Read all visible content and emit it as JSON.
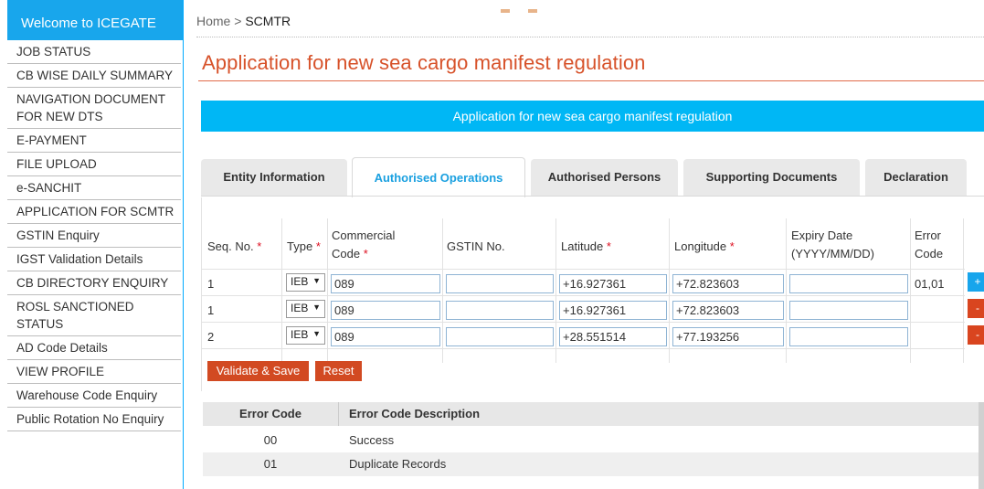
{
  "sidebar": {
    "welcome": "Welcome to ICEGATE",
    "items": [
      {
        "label": "JOB STATUS"
      },
      {
        "label": "CB WISE DAILY SUMMARY"
      },
      {
        "label": "NAVIGATION DOCUMENT FOR NEW DTS"
      },
      {
        "label": "E-PAYMENT"
      },
      {
        "label": "FILE UPLOAD"
      },
      {
        "label": "e-SANCHIT"
      },
      {
        "label": "APPLICATION FOR SCMTR"
      },
      {
        "label": "GSTIN Enquiry"
      },
      {
        "label": "IGST Validation Details"
      },
      {
        "label": "CB DIRECTORY ENQUIRY"
      },
      {
        "label": "ROSL SANCTIONED STATUS"
      },
      {
        "label": "AD Code Details"
      },
      {
        "label": "VIEW PROFILE"
      },
      {
        "label": "Warehouse Code Enquiry"
      },
      {
        "label": "Public Rotation No Enquiry"
      }
    ]
  },
  "breadcrumb": {
    "home": "Home",
    "sep": " > ",
    "current": "SCMTR"
  },
  "page_title": "Application for new sea cargo manifest regulation",
  "banner": "Application for new sea cargo manifest regulation",
  "tabs": [
    {
      "label": "Entity Information"
    },
    {
      "label": "Authorised Operations"
    },
    {
      "label": "Authorised Persons"
    },
    {
      "label": "Supporting Documents"
    },
    {
      "label": "Declaration"
    }
  ],
  "grid": {
    "headers": {
      "seq": "Seq. No.",
      "type": "Type",
      "commercial_1": "Commercial",
      "commercial_2": "Code",
      "gstin": "GSTIN No.",
      "latitude": "Latitude",
      "longitude": "Longitude",
      "expiry_1": "Expiry Date",
      "expiry_2": "(YYYY/MM/DD)",
      "error_1": "Error",
      "error_2": "Code",
      "required_mark": "*"
    },
    "rows": [
      {
        "seq": "1",
        "type": "IEB",
        "code": "089",
        "gstin": "",
        "latitude": "+16.927361",
        "longitude": "+72.823603",
        "expiry": "",
        "error": "01,01",
        "action": "+"
      },
      {
        "seq": "1",
        "type": "IEB",
        "code": "089",
        "gstin": "",
        "latitude": "+16.927361",
        "longitude": "+72.823603",
        "expiry": "",
        "error": "",
        "action": "-"
      },
      {
        "seq": "2",
        "type": "IEB",
        "code": "089",
        "gstin": "",
        "latitude": "+28.551514",
        "longitude": "+77.193256",
        "expiry": "",
        "error": "",
        "action": "-"
      }
    ],
    "validate_label": "Validate & Save",
    "reset_label": "Reset"
  },
  "error_table": {
    "headers": {
      "code": "Error Code",
      "desc": "Error Code Description"
    },
    "rows": [
      {
        "code": "00",
        "desc": "Success"
      },
      {
        "code": "01",
        "desc": "Duplicate Records"
      }
    ]
  },
  "colors": {
    "accent_blue": "#00b7f5",
    "title_orange": "#d7522a",
    "button_red": "#d24a22"
  }
}
